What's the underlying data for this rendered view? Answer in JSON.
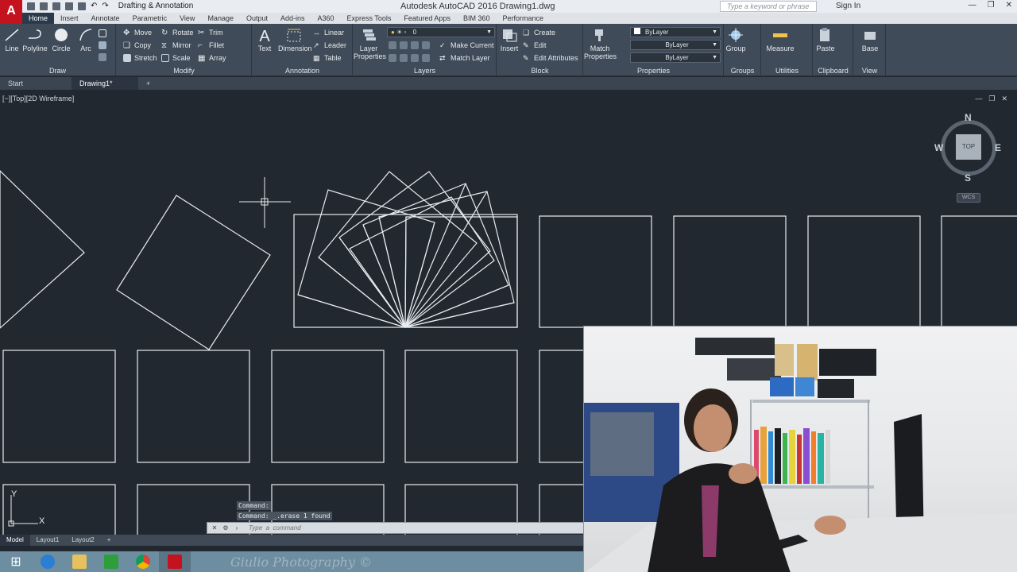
{
  "titlebar": {
    "logo": "A",
    "workspace": "Drafting & Annotation",
    "title": "Autodesk AutoCAD 2016    Drawing1.dwg",
    "search_placeholder": "Type a keyword or phrase",
    "signin": "Sign In"
  },
  "ribbon_tabs": [
    "Home",
    "Insert",
    "Annotate",
    "Parametric",
    "View",
    "Manage",
    "Output",
    "Add-ins",
    "A360",
    "Express Tools",
    "Featured Apps",
    "BIM 360",
    "Performance"
  ],
  "ribbon": {
    "draw": {
      "title": "Draw",
      "line": "Line",
      "polyline": "Polyline",
      "circle": "Circle",
      "arc": "Arc"
    },
    "modify": {
      "title": "Modify",
      "move": "Move",
      "rotate": "Rotate",
      "trim": "Trim",
      "copy": "Copy",
      "mirror": "Mirror",
      "fillet": "Fillet",
      "stretch": "Stretch",
      "scale": "Scale",
      "array": "Array"
    },
    "annotation": {
      "title": "Annotation",
      "text": "Text",
      "dimension": "Dimension",
      "linear": "Linear",
      "leader": "Leader",
      "table": "Table"
    },
    "layers": {
      "title": "Layers",
      "layer_properties": "Layer Properties",
      "current_layer": "0",
      "make_current": "Make Current",
      "match_layer": "Match Layer"
    },
    "block": {
      "title": "Block",
      "insert": "Insert",
      "create": "Create",
      "edit": "Edit",
      "edit_attributes": "Edit Attributes"
    },
    "properties": {
      "title": "Properties",
      "match_properties": "Match Properties",
      "color": "ByLayer",
      "linetype": "ByLayer",
      "lineweight": "ByLayer"
    },
    "groups": {
      "title": "Groups",
      "group": "Group"
    },
    "utilities": {
      "title": "Utilities",
      "measure": "Measure"
    },
    "clipboard": {
      "title": "Clipboard",
      "paste": "Paste"
    },
    "view": {
      "title": "View",
      "base": "Base"
    }
  },
  "file_tabs": [
    "Start",
    "Drawing1*"
  ],
  "viewport": {
    "label": "[−][Top][2D Wireframe]",
    "viewcube": {
      "n": "N",
      "s": "S",
      "e": "E",
      "w": "W",
      "face": "TOP",
      "wcs": "WCS"
    },
    "ucs": {
      "x": "X",
      "y": "Y"
    }
  },
  "command": {
    "history": [
      "Command:",
      "Command:  _.erase 1 found"
    ],
    "placeholder": "Type  a  command"
  },
  "layout_tabs": [
    "Model",
    "Layout1",
    "Layout2"
  ],
  "taskbar": {
    "watermark": "Giulio Photography ©"
  },
  "colors": {
    "canvas": "#212830",
    "ribbon": "#3f4b58",
    "accent": "#c5121f",
    "lines": "#e8ecef"
  }
}
